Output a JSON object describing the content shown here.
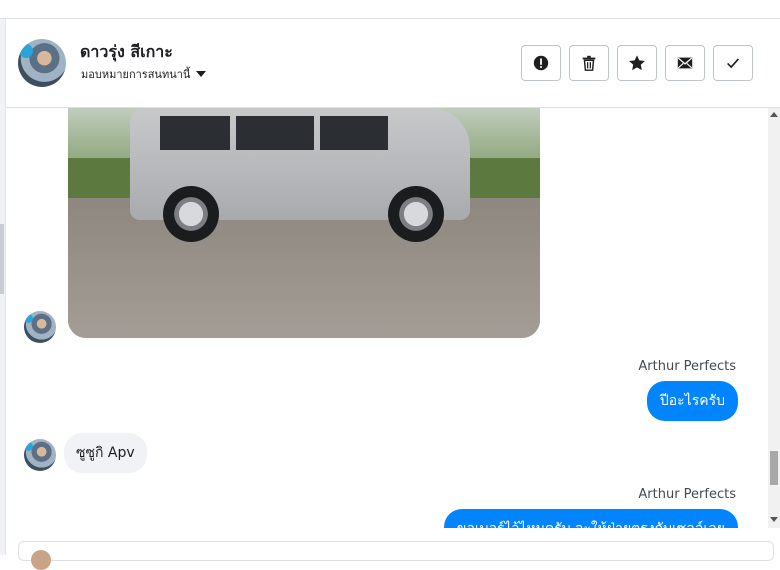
{
  "header": {
    "contact_name": "ดาวรุ่ง สีเกาะ",
    "assign_label": "มอบหมายการสนทนานี้",
    "actions": [
      {
        "name": "spam-button",
        "icon": "exclamation-circle-icon"
      },
      {
        "name": "delete-button",
        "icon": "trash-icon"
      },
      {
        "name": "star-button",
        "icon": "star-icon"
      },
      {
        "name": "mark-unread-button",
        "icon": "envelope-icon"
      },
      {
        "name": "mark-done-button",
        "icon": "checkmark-icon"
      }
    ]
  },
  "messages": [
    {
      "type": "image",
      "from": "contact",
      "content": "car-photo"
    },
    {
      "type": "text",
      "from": "page",
      "sender": "Arthur Perfects",
      "text": "ปีอะไรครับ"
    },
    {
      "type": "text",
      "from": "contact",
      "text": "ซูซูกิ Apv"
    },
    {
      "type": "text",
      "from": "page",
      "sender": "Arthur Perfects",
      "text": "ขอเบอร์ไว้ไหมครับ จะให้ฝ่ายตรงกับเซลล์เลย"
    }
  ],
  "colors": {
    "outgoing_bubble": "#0084ff",
    "incoming_bubble": "#f0f2f5",
    "border": "#bec3c9"
  }
}
